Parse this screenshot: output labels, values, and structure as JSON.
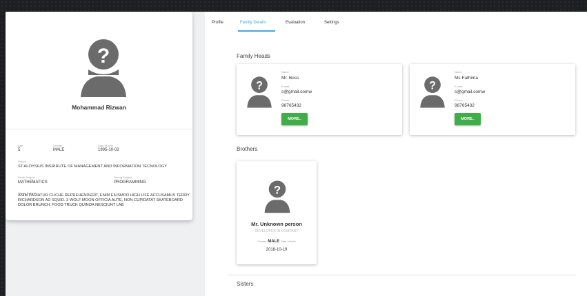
{
  "profile": {
    "name": "Mohammad Rizwan",
    "age_label": "Age",
    "age": "5",
    "gender_label": "Gender",
    "gender": "MALE",
    "dob_label": "Date of birth",
    "dob": "1995-10-02",
    "school_label": "School",
    "school": "ST.ALOYSIUS INSRIRUTE OF MANAGEMENT AND INFORMATION TECNOLOGY",
    "weak_subject_label": "Weak Subject",
    "weak_subject": "MATHEMATICS",
    "strong_subject_label": "Strong Subject",
    "strong_subject": "PROGRAMMING",
    "strong_subject2_label": "Strong Subject",
    "bio": "ANIM PARIATUR CLICHE REPREHENDERIT, ENIM EIUSMOD HIGH LIFE ACCUSAMUS TERRY RICHARDSON AD SQUID. 3 WOLF MOON OFFICIA AUTE, NON CUPIDATAT SKATEBOARD DOLOR BRUNCH. FOOD TRUCK QUINOA NESCIUNT LAB"
  },
  "tabs": [
    {
      "label": "Profile"
    },
    {
      "label": "Family Details"
    },
    {
      "label": "Evaluation"
    },
    {
      "label": "Settings"
    }
  ],
  "family_heads": {
    "title": "Family Heads",
    "name_label": "Name",
    "email_label": "E-mail",
    "phone_label": "Phone",
    "more_label": "MORE..",
    "items": [
      {
        "name": "Mr. Boss",
        "email": "s@gmail.comw",
        "phone": "98765432"
      },
      {
        "name": "Ms Fathima",
        "email": "s@gmail.comw",
        "phone": "98765432"
      }
    ]
  },
  "brothers": {
    "title": "Brothers",
    "items": [
      {
        "name": "Mr. Unknown person",
        "job": "DEVELOPER IN COMPANY",
        "gender_label": "Gender",
        "gender": "MALE",
        "dob_label": "Date of birth",
        "dob": "2018-10-19"
      }
    ]
  },
  "sisters": {
    "title": "Sisters"
  },
  "colors": {
    "accent": "#4aa3df",
    "more_button": "#3fae49",
    "avatar": "#6b6b6b"
  },
  "icons": {
    "avatar": "person-silhouette-question-mark"
  }
}
